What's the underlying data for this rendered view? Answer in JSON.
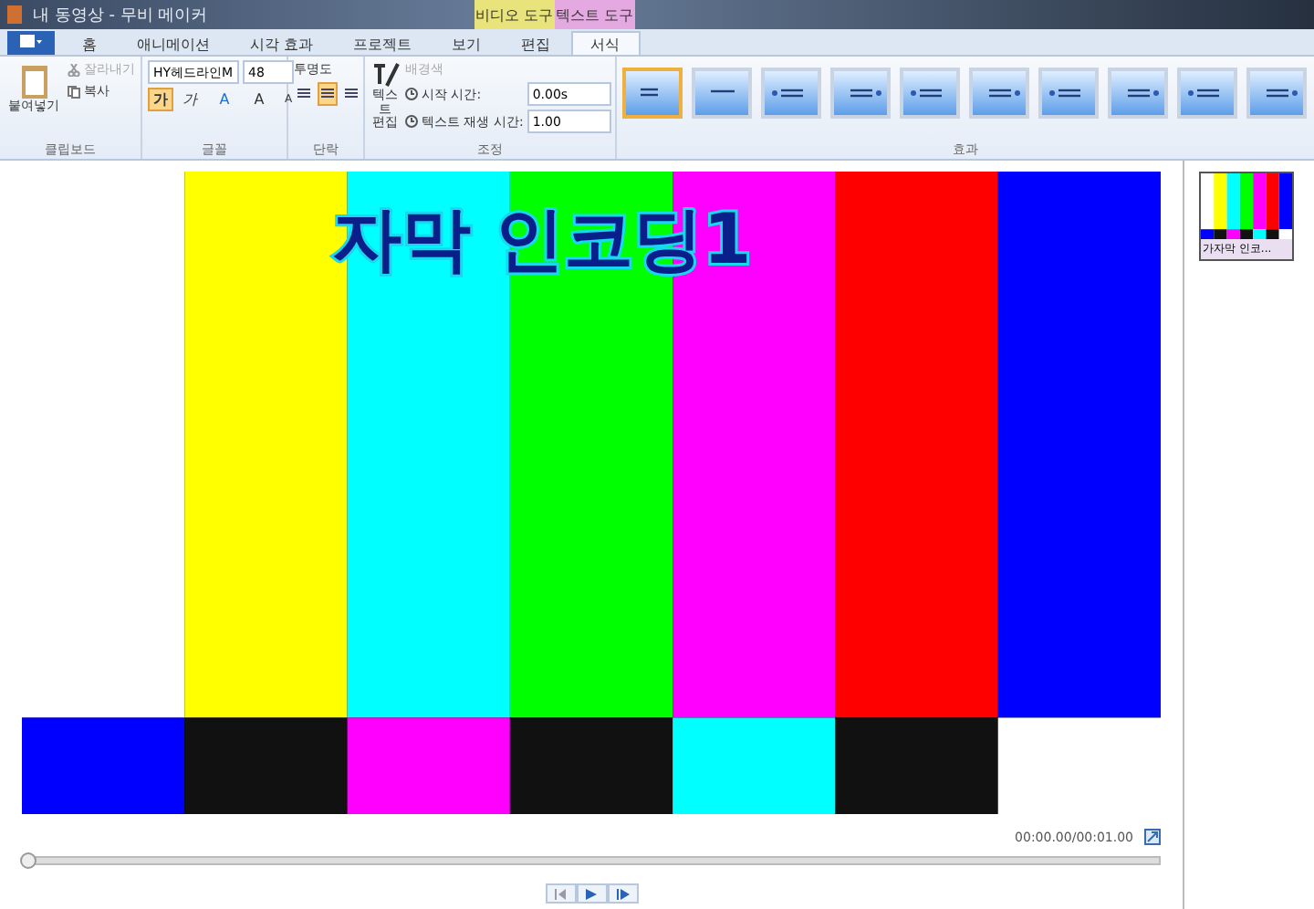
{
  "window": {
    "title": "내 동영상 - 무비 메이커"
  },
  "context_tabs": [
    {
      "label": "비디오 도구",
      "color": "#e8e37a"
    },
    {
      "label": "텍스트 도구",
      "color": "#e3a9e0"
    }
  ],
  "tabs": [
    {
      "label": "홈",
      "selected": false
    },
    {
      "label": "애니메이션",
      "selected": false
    },
    {
      "label": "시각 효과",
      "selected": false
    },
    {
      "label": "프로젝트",
      "selected": false
    },
    {
      "label": "보기",
      "selected": false
    },
    {
      "label": "편집",
      "selected": false
    },
    {
      "label": "서식",
      "selected": true
    }
  ],
  "clipboard": {
    "paste": "붙여넣기",
    "cut": {
      "label": "잘라내기",
      "disabled": true
    },
    "copy": {
      "label": "복사",
      "disabled": false
    },
    "group": "클립보드"
  },
  "font": {
    "family": "HY헤드라인M",
    "size": "48",
    "bold": {
      "label": "가",
      "selected": true
    },
    "italic": {
      "label": "가",
      "selected": false
    },
    "color_label": "A",
    "grow": "A",
    "shrink": "A",
    "group": "글꼴"
  },
  "paragraph": {
    "transparency": "투명도",
    "align": [
      {
        "selected": false
      },
      {
        "selected": true
      },
      {
        "selected": false
      }
    ],
    "group": "단락"
  },
  "adjust": {
    "edit_text": "텍스트 편집",
    "background": {
      "label": "배경색",
      "disabled": true
    },
    "start_label": "시작 시간:",
    "start_value": "0.00s",
    "duration_label": "텍스트 재생 시간:",
    "duration_value": "1.00",
    "group": "조정"
  },
  "effects": {
    "items": [
      {
        "selected": true
      },
      {
        "selected": false
      },
      {
        "selected": false
      },
      {
        "selected": false
      },
      {
        "selected": false
      },
      {
        "selected": false
      },
      {
        "selected": false
      },
      {
        "selected": false
      },
      {
        "selected": false
      },
      {
        "selected": false
      }
    ],
    "group": "효과"
  },
  "preview": {
    "caption": "자막 인코딩1",
    "time": "00:00.00/00:01.00"
  },
  "storyboard": {
    "clip_label": "가자막 인코..."
  }
}
